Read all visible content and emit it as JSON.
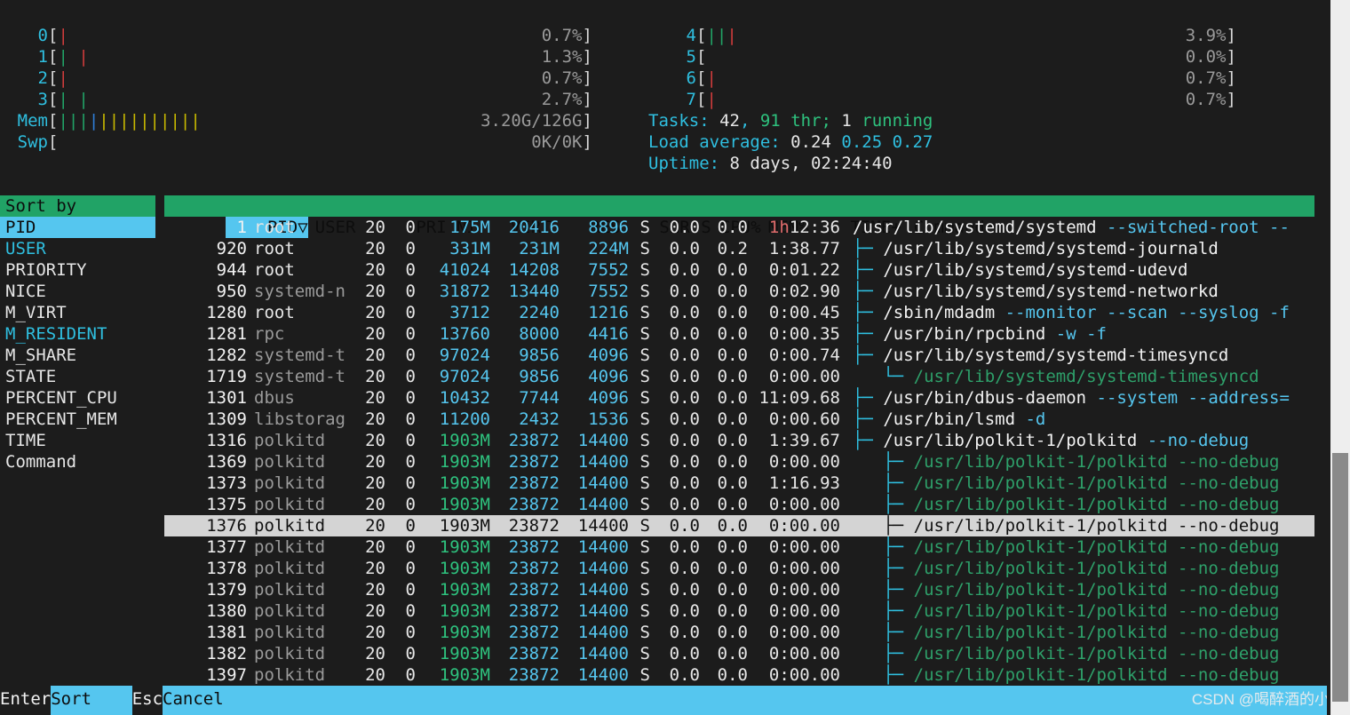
{
  "meters": {
    "cpus_left": [
      {
        "id": "0",
        "pct": "0.7%",
        "bars": [
          {
            "ch": "|",
            "color": "red"
          }
        ]
      },
      {
        "id": "1",
        "pct": "1.3%",
        "bars": [
          {
            "ch": "|",
            "color": "green"
          },
          {
            "ch": " ",
            "color": "none"
          },
          {
            "ch": "|",
            "color": "red"
          }
        ]
      },
      {
        "id": "2",
        "pct": "0.7%",
        "bars": [
          {
            "ch": "|",
            "color": "red"
          }
        ]
      },
      {
        "id": "3",
        "pct": "2.7%",
        "bars": [
          {
            "ch": "|",
            "color": "green"
          },
          {
            "ch": " ",
            "color": "none"
          },
          {
            "ch": "|",
            "color": "green"
          }
        ]
      }
    ],
    "cpus_right": [
      {
        "id": "4",
        "pct": "3.9%",
        "bars": [
          {
            "ch": "|",
            "color": "green"
          },
          {
            "ch": "|",
            "color": "green"
          },
          {
            "ch": "|",
            "color": "red"
          }
        ]
      },
      {
        "id": "5",
        "pct": "0.0%",
        "bars": []
      },
      {
        "id": "6",
        "pct": "0.7%",
        "bars": [
          {
            "ch": "|",
            "color": "red"
          }
        ]
      },
      {
        "id": "7",
        "pct": "0.7%",
        "bars": [
          {
            "ch": "|",
            "color": "red"
          }
        ]
      }
    ],
    "mem": {
      "label": "Mem",
      "value": "3.20G/126G",
      "bars": [
        {
          "ch": "|",
          "color": "green"
        },
        {
          "ch": "|",
          "color": "green"
        },
        {
          "ch": "|",
          "color": "green"
        },
        {
          "ch": "|",
          "color": "blue"
        },
        {
          "ch": "|",
          "color": "yellow"
        },
        {
          "ch": "|",
          "color": "yellow"
        },
        {
          "ch": "|",
          "color": "yellow"
        },
        {
          "ch": "|",
          "color": "yellow"
        },
        {
          "ch": "|",
          "color": "yellow"
        },
        {
          "ch": "|",
          "color": "yellow"
        },
        {
          "ch": "|",
          "color": "yellow"
        },
        {
          "ch": "|",
          "color": "yellow"
        },
        {
          "ch": "|",
          "color": "yellow"
        },
        {
          "ch": "|",
          "color": "yellow"
        }
      ]
    },
    "swp": {
      "label": "Swp",
      "value": "0K/0K",
      "bars": []
    }
  },
  "system": {
    "tasks_label": "Tasks: ",
    "tasks_count": "42",
    "tasks_sep": ", ",
    "thr_count": "91",
    "thr_label": " thr; ",
    "running_count": "1",
    "running_label": " running",
    "load_label": "Load average: ",
    "load_1": "0.24",
    "load_5": "0.25",
    "load_15": "0.27",
    "uptime_label": "Uptime: ",
    "uptime_value": "8 days, 02:24:40"
  },
  "sort_panel": {
    "title": "Sort by",
    "items": [
      {
        "label": "PID",
        "state": "selected"
      },
      {
        "label": "USER",
        "state": "cyan"
      },
      {
        "label": "PRIORITY",
        "state": "normal"
      },
      {
        "label": "NICE",
        "state": "normal"
      },
      {
        "label": "M_VIRT",
        "state": "normal"
      },
      {
        "label": "M_RESIDENT",
        "state": "cyan"
      },
      {
        "label": "M_SHARE",
        "state": "normal"
      },
      {
        "label": "STATE",
        "state": "normal"
      },
      {
        "label": "PERCENT_CPU",
        "state": "normal"
      },
      {
        "label": "PERCENT_MEM",
        "state": "normal"
      },
      {
        "label": "TIME",
        "state": "normal"
      },
      {
        "label": "Command",
        "state": "normal"
      }
    ]
  },
  "table": {
    "headers": {
      "pid": "PID▽",
      "user": "USER",
      "pri": "PRI",
      "ni": "NI",
      "virt": "VIRT",
      "res": "RES",
      "shr": "SHR",
      "s": "S",
      "cpu": "CPU%",
      "mem": "MEM%",
      "time": "TIME+",
      "command": "Command"
    },
    "rows": [
      {
        "pid": "1",
        "user": "root",
        "user_kind": "root",
        "pri": "20",
        "ni": "0",
        "virt": "175M",
        "virt_kind": "cyan",
        "res": "20416",
        "shr": "8896",
        "s": "S",
        "cpu": "0.0",
        "mem": "0.0",
        "time": "1h12:36",
        "time_kind": "hour",
        "tree": "",
        "cmd": "/usr/lib/systemd/systemd",
        "args": " --switched-root --",
        "cmd_kind": "base"
      },
      {
        "pid": "920",
        "user": "root",
        "user_kind": "root",
        "pri": "20",
        "ni": "0",
        "virt": "331M",
        "virt_kind": "cyan",
        "res": "231M",
        "shr": "224M",
        "s": "S",
        "cpu": "0.0",
        "mem": "0.2",
        "time": "1:38.77",
        "time_kind": "normal",
        "tree": "├─ ",
        "cmd": "/usr/lib/systemd/systemd-journald",
        "args": "",
        "cmd_kind": "base"
      },
      {
        "pid": "944",
        "user": "root",
        "user_kind": "root",
        "pri": "20",
        "ni": "0",
        "virt": "41024",
        "virt_kind": "cyan",
        "res": "14208",
        "shr": "7552",
        "s": "S",
        "cpu": "0.0",
        "mem": "0.0",
        "time": "0:01.22",
        "time_kind": "normal",
        "tree": "├─ ",
        "cmd": "/usr/lib/systemd/systemd-udevd",
        "args": "",
        "cmd_kind": "base"
      },
      {
        "pid": "950",
        "user": "systemd-n",
        "user_kind": "dim",
        "pri": "20",
        "ni": "0",
        "virt": "31872",
        "virt_kind": "cyan",
        "res": "13440",
        "shr": "7552",
        "s": "S",
        "cpu": "0.0",
        "mem": "0.0",
        "time": "0:02.90",
        "time_kind": "normal",
        "tree": "├─ ",
        "cmd": "/usr/lib/systemd/systemd-networkd",
        "args": "",
        "cmd_kind": "base"
      },
      {
        "pid": "1280",
        "user": "root",
        "user_kind": "root",
        "pri": "20",
        "ni": "0",
        "virt": "3712",
        "virt_kind": "cyan",
        "res": "2240",
        "shr": "1216",
        "s": "S",
        "cpu": "0.0",
        "mem": "0.0",
        "time": "0:00.45",
        "time_kind": "normal",
        "tree": "├─ ",
        "cmd": "/sbin/mdadm",
        "args": " --monitor --scan --syslog -f",
        "cmd_kind": "base"
      },
      {
        "pid": "1281",
        "user": "rpc",
        "user_kind": "dim",
        "pri": "20",
        "ni": "0",
        "virt": "13760",
        "virt_kind": "cyan",
        "res": "8000",
        "shr": "4416",
        "s": "S",
        "cpu": "0.0",
        "mem": "0.0",
        "time": "0:00.35",
        "time_kind": "normal",
        "tree": "├─ ",
        "cmd": "/usr/bin/rpcbind",
        "args": " -w -f",
        "cmd_kind": "base"
      },
      {
        "pid": "1282",
        "user": "systemd-t",
        "user_kind": "dim",
        "pri": "20",
        "ni": "0",
        "virt": "97024",
        "virt_kind": "cyan",
        "res": "9856",
        "shr": "4096",
        "s": "S",
        "cpu": "0.0",
        "mem": "0.0",
        "time": "0:00.74",
        "time_kind": "normal",
        "tree": "├─ ",
        "cmd": "/usr/lib/systemd/systemd-timesyncd",
        "args": "",
        "cmd_kind": "base"
      },
      {
        "pid": "1719",
        "user": "systemd-t",
        "user_kind": "dim",
        "pri": "20",
        "ni": "0",
        "virt": "97024",
        "virt_kind": "cyan",
        "res": "9856",
        "shr": "4096",
        "s": "S",
        "cpu": "0.0",
        "mem": "0.0",
        "time": "0:00.00",
        "time_kind": "normal",
        "tree": "   └─ ",
        "cmd": "/usr/lib/systemd/systemd-timesyncd",
        "args": "",
        "cmd_kind": "thread"
      },
      {
        "pid": "1301",
        "user": "dbus",
        "user_kind": "dim",
        "pri": "20",
        "ni": "0",
        "virt": "10432",
        "virt_kind": "cyan",
        "res": "7744",
        "shr": "4096",
        "s": "S",
        "cpu": "0.0",
        "mem": "0.0",
        "time": "11:09.68",
        "time_kind": "normal",
        "tree": "├─ ",
        "cmd": "/usr/bin/dbus-daemon",
        "args": " --system --address=",
        "cmd_kind": "base"
      },
      {
        "pid": "1309",
        "user": "libstorag",
        "user_kind": "dim",
        "pri": "20",
        "ni": "0",
        "virt": "11200",
        "virt_kind": "cyan",
        "res": "2432",
        "shr": "1536",
        "s": "S",
        "cpu": "0.0",
        "mem": "0.0",
        "time": "0:00.60",
        "time_kind": "normal",
        "tree": "├─ ",
        "cmd": "/usr/bin/lsmd",
        "args": " -d",
        "cmd_kind": "base"
      },
      {
        "pid": "1316",
        "user": "polkitd",
        "user_kind": "dim",
        "pri": "20",
        "ni": "0",
        "virt": "1903M",
        "virt_kind": "green",
        "res": "23872",
        "shr": "14400",
        "s": "S",
        "cpu": "0.0",
        "mem": "0.0",
        "time": "1:39.67",
        "time_kind": "normal",
        "tree": "├─ ",
        "cmd": "/usr/lib/polkit-1/polkitd",
        "args": " --no-debug",
        "cmd_kind": "base"
      },
      {
        "pid": "1369",
        "user": "polkitd",
        "user_kind": "dim",
        "pri": "20",
        "ni": "0",
        "virt": "1903M",
        "virt_kind": "green",
        "res": "23872",
        "shr": "14400",
        "s": "S",
        "cpu": "0.0",
        "mem": "0.0",
        "time": "0:00.00",
        "time_kind": "normal",
        "tree": "   ├─ ",
        "cmd": "/usr/lib/polkit-1/polkitd --no-debug",
        "args": "",
        "cmd_kind": "thread"
      },
      {
        "pid": "1373",
        "user": "polkitd",
        "user_kind": "dim",
        "pri": "20",
        "ni": "0",
        "virt": "1903M",
        "virt_kind": "green",
        "res": "23872",
        "shr": "14400",
        "s": "S",
        "cpu": "0.0",
        "mem": "0.0",
        "time": "1:16.93",
        "time_kind": "normal",
        "tree": "   ├─ ",
        "cmd": "/usr/lib/polkit-1/polkitd --no-debug",
        "args": "",
        "cmd_kind": "thread"
      },
      {
        "pid": "1375",
        "user": "polkitd",
        "user_kind": "dim",
        "pri": "20",
        "ni": "0",
        "virt": "1903M",
        "virt_kind": "green",
        "res": "23872",
        "shr": "14400",
        "s": "S",
        "cpu": "0.0",
        "mem": "0.0",
        "time": "0:00.00",
        "time_kind": "normal",
        "tree": "   ├─ ",
        "cmd": "/usr/lib/polkit-1/polkitd --no-debug",
        "args": "",
        "cmd_kind": "thread"
      },
      {
        "pid": "1376",
        "user": "polkitd",
        "user_kind": "dim",
        "pri": "20",
        "ni": "0",
        "virt": "1903M",
        "virt_kind": "green",
        "res": "23872",
        "shr": "14400",
        "s": "S",
        "cpu": "0.0",
        "mem": "0.0",
        "time": "0:00.00",
        "time_kind": "normal",
        "tree": "   ├─ ",
        "cmd": "/usr/lib/polkit-1/polkitd --no-debug",
        "args": "",
        "cmd_kind": "thread",
        "selected": true
      },
      {
        "pid": "1377",
        "user": "polkitd",
        "user_kind": "dim",
        "pri": "20",
        "ni": "0",
        "virt": "1903M",
        "virt_kind": "green",
        "res": "23872",
        "shr": "14400",
        "s": "S",
        "cpu": "0.0",
        "mem": "0.0",
        "time": "0:00.00",
        "time_kind": "normal",
        "tree": "   ├─ ",
        "cmd": "/usr/lib/polkit-1/polkitd --no-debug",
        "args": "",
        "cmd_kind": "thread"
      },
      {
        "pid": "1378",
        "user": "polkitd",
        "user_kind": "dim",
        "pri": "20",
        "ni": "0",
        "virt": "1903M",
        "virt_kind": "green",
        "res": "23872",
        "shr": "14400",
        "s": "S",
        "cpu": "0.0",
        "mem": "0.0",
        "time": "0:00.00",
        "time_kind": "normal",
        "tree": "   ├─ ",
        "cmd": "/usr/lib/polkit-1/polkitd --no-debug",
        "args": "",
        "cmd_kind": "thread"
      },
      {
        "pid": "1379",
        "user": "polkitd",
        "user_kind": "dim",
        "pri": "20",
        "ni": "0",
        "virt": "1903M",
        "virt_kind": "green",
        "res": "23872",
        "shr": "14400",
        "s": "S",
        "cpu": "0.0",
        "mem": "0.0",
        "time": "0:00.00",
        "time_kind": "normal",
        "tree": "   ├─ ",
        "cmd": "/usr/lib/polkit-1/polkitd --no-debug",
        "args": "",
        "cmd_kind": "thread"
      },
      {
        "pid": "1380",
        "user": "polkitd",
        "user_kind": "dim",
        "pri": "20",
        "ni": "0",
        "virt": "1903M",
        "virt_kind": "green",
        "res": "23872",
        "shr": "14400",
        "s": "S",
        "cpu": "0.0",
        "mem": "0.0",
        "time": "0:00.00",
        "time_kind": "normal",
        "tree": "   ├─ ",
        "cmd": "/usr/lib/polkit-1/polkitd --no-debug",
        "args": "",
        "cmd_kind": "thread"
      },
      {
        "pid": "1381",
        "user": "polkitd",
        "user_kind": "dim",
        "pri": "20",
        "ni": "0",
        "virt": "1903M",
        "virt_kind": "green",
        "res": "23872",
        "shr": "14400",
        "s": "S",
        "cpu": "0.0",
        "mem": "0.0",
        "time": "0:00.00",
        "time_kind": "normal",
        "tree": "   ├─ ",
        "cmd": "/usr/lib/polkit-1/polkitd --no-debug",
        "args": "",
        "cmd_kind": "thread"
      },
      {
        "pid": "1382",
        "user": "polkitd",
        "user_kind": "dim",
        "pri": "20",
        "ni": "0",
        "virt": "1903M",
        "virt_kind": "green",
        "res": "23872",
        "shr": "14400",
        "s": "S",
        "cpu": "0.0",
        "mem": "0.0",
        "time": "0:00.00",
        "time_kind": "normal",
        "tree": "   ├─ ",
        "cmd": "/usr/lib/polkit-1/polkitd --no-debug",
        "args": "",
        "cmd_kind": "thread"
      },
      {
        "pid": "1397",
        "user": "polkitd",
        "user_kind": "dim",
        "pri": "20",
        "ni": "0",
        "virt": "1903M",
        "virt_kind": "green",
        "res": "23872",
        "shr": "14400",
        "s": "S",
        "cpu": "0.0",
        "mem": "0.0",
        "time": "0:00.00",
        "time_kind": "normal",
        "tree": "   ├─ ",
        "cmd": "/usr/lib/polkit-1/polkitd --no-debug",
        "args": "",
        "cmd_kind": "thread"
      }
    ]
  },
  "footer": {
    "items": [
      {
        "key": "Enter",
        "label": "Sort    "
      },
      {
        "key": "Esc",
        "label": "Cancel"
      }
    ],
    "watermark": "CSDN @喝醉酒的小白"
  },
  "colors": {
    "background": "#1c1c1c",
    "accent_cyan": "#55c6ef",
    "accent_green": "#21a366",
    "bar_red": "#cf3c3c",
    "bar_yellow": "#c8b900",
    "selection": "#d4d4d4"
  }
}
